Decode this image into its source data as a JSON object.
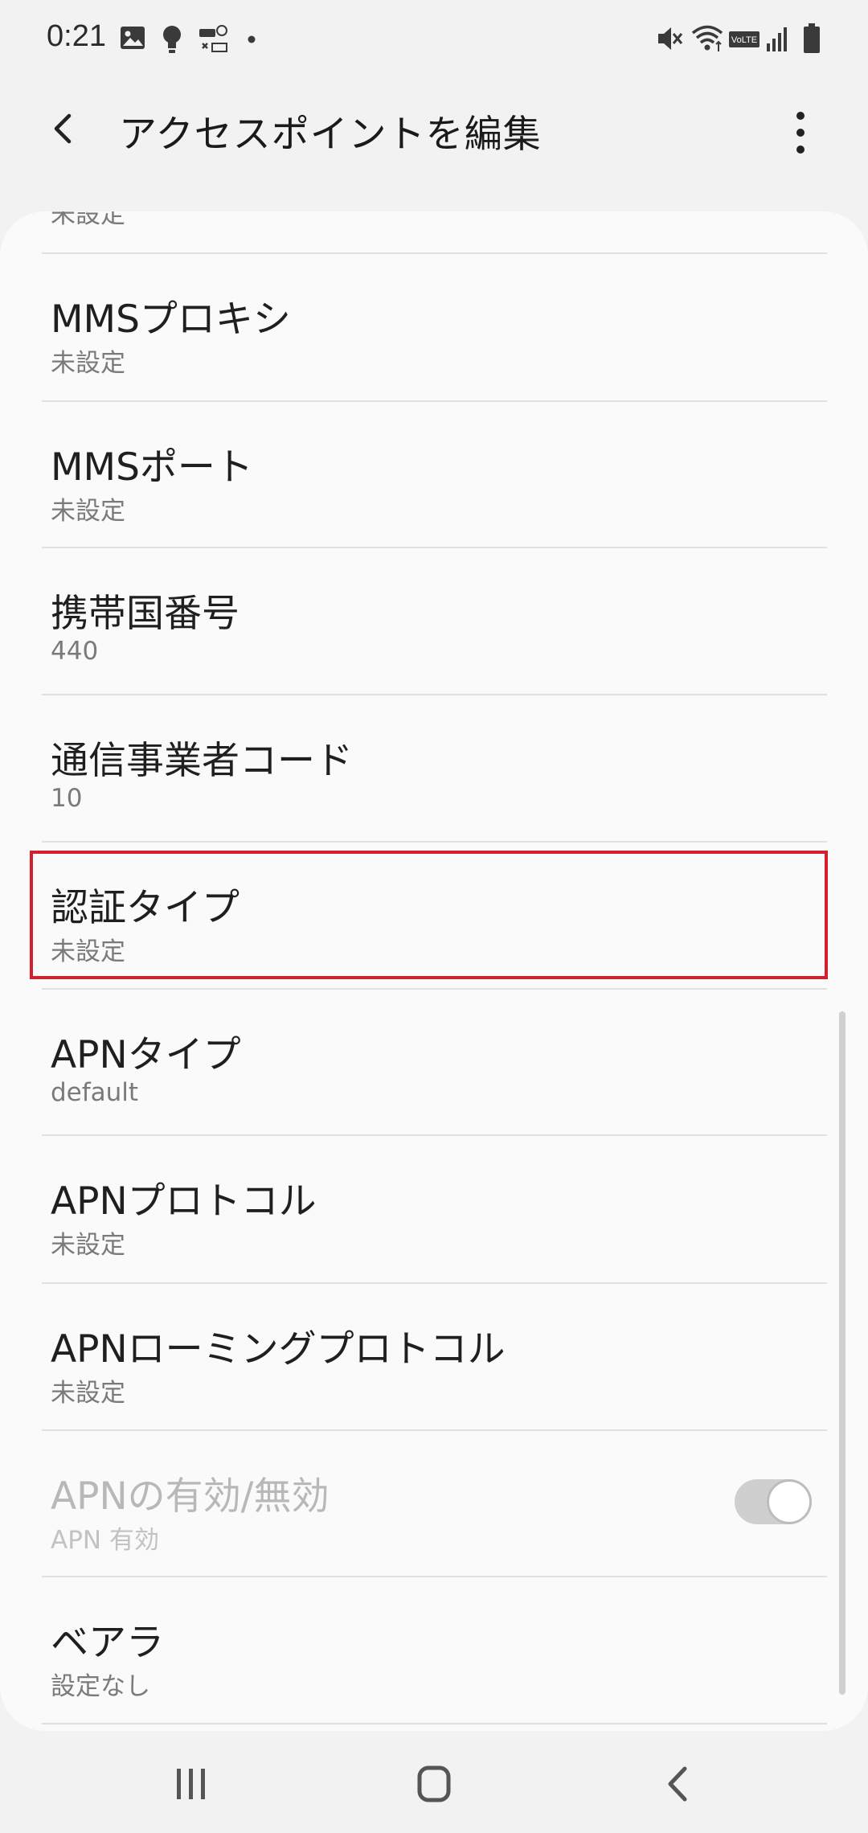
{
  "status": {
    "time": "0:21",
    "icons": [
      "gallery-icon",
      "bulb-icon",
      "voicemail-icon",
      "dot-icon",
      "mute-icon",
      "wifi-icon",
      "volte-icon",
      "signal-icon",
      "battery-icon"
    ],
    "volte_label": "VoLTE"
  },
  "header": {
    "title": "アクセスポイントを編集",
    "back_icon": "back-chevron-icon",
    "more_icon": "more-vert-icon"
  },
  "list": {
    "partial_top_value": "未設定",
    "items": [
      {
        "title": "MMSプロキシ",
        "value": "未設定"
      },
      {
        "title": "MMSポート",
        "value": "未設定"
      },
      {
        "title": "携帯国番号",
        "value": "440"
      },
      {
        "title": "通信事業者コード",
        "value": "10"
      },
      {
        "title": "認証タイプ",
        "value": "未設定"
      },
      {
        "title": "APNタイプ",
        "value": "default"
      },
      {
        "title": "APNプロトコル",
        "value": "未設定"
      },
      {
        "title": "APNローミングプロトコル",
        "value": "未設定"
      },
      {
        "title": "APNの有効/無効",
        "value": "APN 有効",
        "toggle_on": true,
        "disabled": true
      },
      {
        "title": "ベアラ",
        "value": "設定なし"
      }
    ]
  },
  "highlight_color": "#d41f2f",
  "navbar": {
    "icons": [
      "recents-icon",
      "home-icon",
      "back-icon"
    ]
  }
}
